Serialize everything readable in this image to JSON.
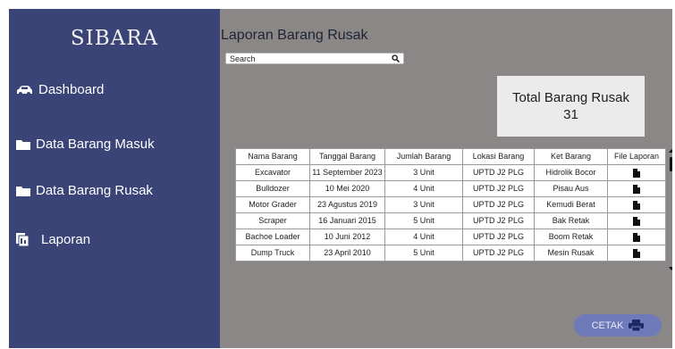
{
  "brand": "SIBARA",
  "sidebar": {
    "items": [
      {
        "label": "Dashboard",
        "icon": "car-icon"
      },
      {
        "label": "Data Barang Masuk",
        "icon": "folder-icon"
      },
      {
        "label": "Data Barang Rusak",
        "icon": "folder-icon"
      },
      {
        "label": "Laporan",
        "icon": "report-icon"
      }
    ]
  },
  "main": {
    "title": "Laporan Barang Rusak",
    "search": {
      "placeholder": "Search",
      "icon": "search-icon"
    },
    "total": {
      "label": "Total Barang Rusak",
      "value": "31"
    },
    "table": {
      "headers": [
        "Nama Barang",
        "Tanggal Barang",
        "Jumlah Barang",
        "Lokasi Barang",
        "Ket Barang",
        "File Laporan"
      ],
      "rows": [
        {
          "nama": "Excavator",
          "tanggal": "11 September 2023",
          "jumlah": "3 Unit",
          "lokasi": "UPTD J2 PLG",
          "ket": "Hidrolik Bocor"
        },
        {
          "nama": "Bulldozer",
          "tanggal": "10 Mei 2020",
          "jumlah": "4 Unit",
          "lokasi": "UPTD J2 PLG",
          "ket": "Pisau Aus"
        },
        {
          "nama": "Motor Grader",
          "tanggal": "23 Agustus 2019",
          "jumlah": "3 Unit",
          "lokasi": "UPTD J2 PLG",
          "ket": "Kemudi Berat"
        },
        {
          "nama": "Scraper",
          "tanggal": "16 Januari 2015",
          "jumlah": "5 Unit",
          "lokasi": "UPTD J2 PLG",
          "ket": "Bak Retak"
        },
        {
          "nama": "Bachoe Loader",
          "tanggal": "10 Juni 2012",
          "jumlah": "4 Unit",
          "lokasi": "UPTD J2 PLG",
          "ket": "Boom Retak"
        },
        {
          "nama": "Dump Truck",
          "tanggal": "23 April 2010",
          "jumlah": "5 Unit",
          "lokasi": "UPTD J2 PLG",
          "ket": "Mesin Rusak"
        }
      ],
      "file_icon": "file-icon"
    },
    "cetak_label": "CETAK",
    "cetak_icon": "printer-icon"
  },
  "colors": {
    "sidebar": "#3a4477",
    "content_bg": "#8b8787",
    "card": "#ebebeb",
    "button": "#6f7ab8"
  }
}
